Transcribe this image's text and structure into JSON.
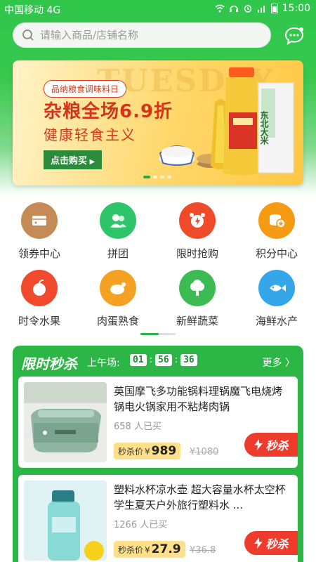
{
  "status_bar": {
    "carrier": "中国移动 4G",
    "time": "15:00"
  },
  "search": {
    "placeholder": "请输入商品/店铺名称"
  },
  "banner": {
    "watermark": "TUESDAY",
    "tag": "品纳粮食调味料日",
    "headline": "杂粮全场6.9折",
    "subtitle": "健康轻食主义",
    "cta": "点击购买",
    "package_label": "东北大米"
  },
  "categories": [
    {
      "label": "领券中心",
      "icon": "coupon-icon",
      "color": "#c58a55"
    },
    {
      "label": "拼团",
      "icon": "group-icon",
      "color": "#2ec46a"
    },
    {
      "label": "限时抢购",
      "icon": "alarm-clock-icon",
      "color": "#ef4a2a"
    },
    {
      "label": "积分中心",
      "icon": "coins-icon",
      "color": "#f59a12"
    },
    {
      "label": "时令水果",
      "icon": "fruit-icon",
      "color": "#f0492b"
    },
    {
      "label": "肉蛋熟食",
      "icon": "chicken-icon",
      "color": "#f5a224"
    },
    {
      "label": "新鲜蔬菜",
      "icon": "vegetable-icon",
      "color": "#3dbb53"
    },
    {
      "label": "海鲜水产",
      "icon": "fish-icon",
      "color": "#34a6ea"
    }
  ],
  "flash_sale": {
    "title": "限时秒杀",
    "session_label": "上午场:",
    "timer": {
      "hours": "01",
      "minutes": "56",
      "seconds": "36"
    },
    "more": "更多 〉",
    "products": [
      {
        "name": "英国摩飞多功能锅料理锅魔飞电烧烤锅电火锅家用不粘烤肉锅",
        "sold": "658 人已买",
        "price_label": "秒杀价",
        "currency": "¥",
        "price": "989",
        "original_price": "¥1080",
        "buy_label": "秒杀"
      },
      {
        "name": "塑料水杯凉水壶 超大容量水杯太空杯学生夏天户外旅行塑料水 ...",
        "sold": "1266 人已买",
        "price_label": "秒杀价",
        "currency": "¥",
        "price": "27.9",
        "original_price": "¥36.8",
        "buy_label": "秒杀"
      }
    ]
  },
  "colors": {
    "brand_green": "#2bb645",
    "flash_red": "#ef3b2b",
    "price_bg": "#ffe08a"
  }
}
